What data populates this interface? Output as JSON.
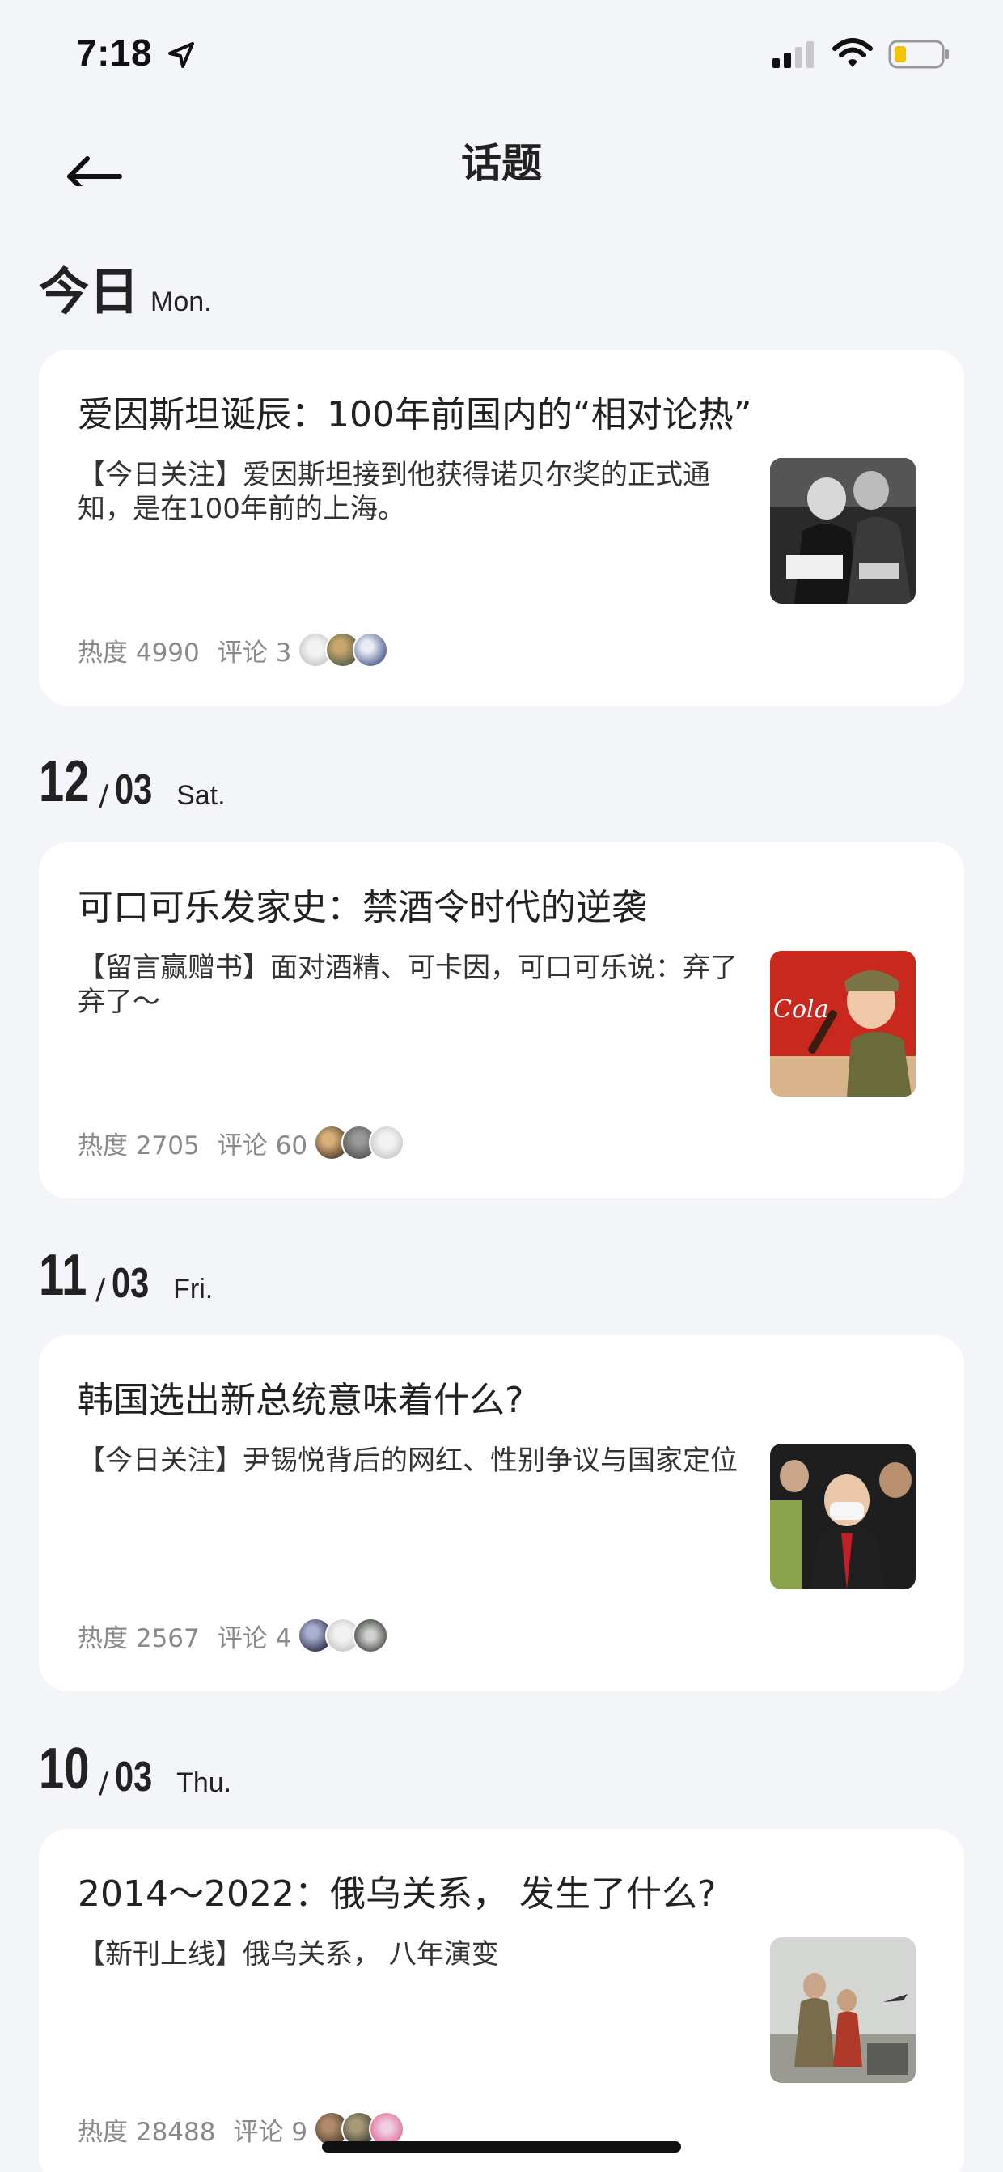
{
  "status_bar": {
    "time": "7:18",
    "icons": [
      "location-arrow-icon",
      "cellular-signal-icon",
      "wifi-icon",
      "battery-low-icon"
    ],
    "battery_color": "#f5c400"
  },
  "header": {
    "title": "话题",
    "back_icon": "arrow-left-icon"
  },
  "sections": [
    {
      "day": "今日",
      "weekday": "Mon.",
      "card": {
        "title": "爱因斯坦诞辰：100年前国内的“相对论热”",
        "description": "【今日关注】爱因斯坦接到他获得诺贝尔奖的正式通知，是在100年前的上海。",
        "heat": "热度 4990",
        "comments": "评论 3"
      }
    },
    {
      "day": "12",
      "slash": "/",
      "month": "03",
      "weekday": "Sat.",
      "card": {
        "title": "可口可乐发家史：禁酒令时代的逆袭",
        "description": "【留言赢赠书】面对酒精、可卡因，可口可乐说：弃了弃了～",
        "heat": "热度 2705",
        "comments": "评论 60"
      }
    },
    {
      "day": "11",
      "slash": "/",
      "month": "03",
      "weekday": "Fri.",
      "card": {
        "title": "韩国选出新总统意味着什么?",
        "description": "【今日关注】尹锡悦背后的网红、性别争议与国家定位",
        "heat": "热度 2567",
        "comments": "评论 4"
      }
    },
    {
      "day": "10",
      "slash": "/",
      "month": "03",
      "weekday": "Thu.",
      "card": {
        "title": "2014～2022：俄乌关系， 发生了什么?",
        "description": "【新刊上线】俄乌关系， 八年演变",
        "heat": "热度 28488",
        "comments": "评论 9"
      }
    }
  ]
}
